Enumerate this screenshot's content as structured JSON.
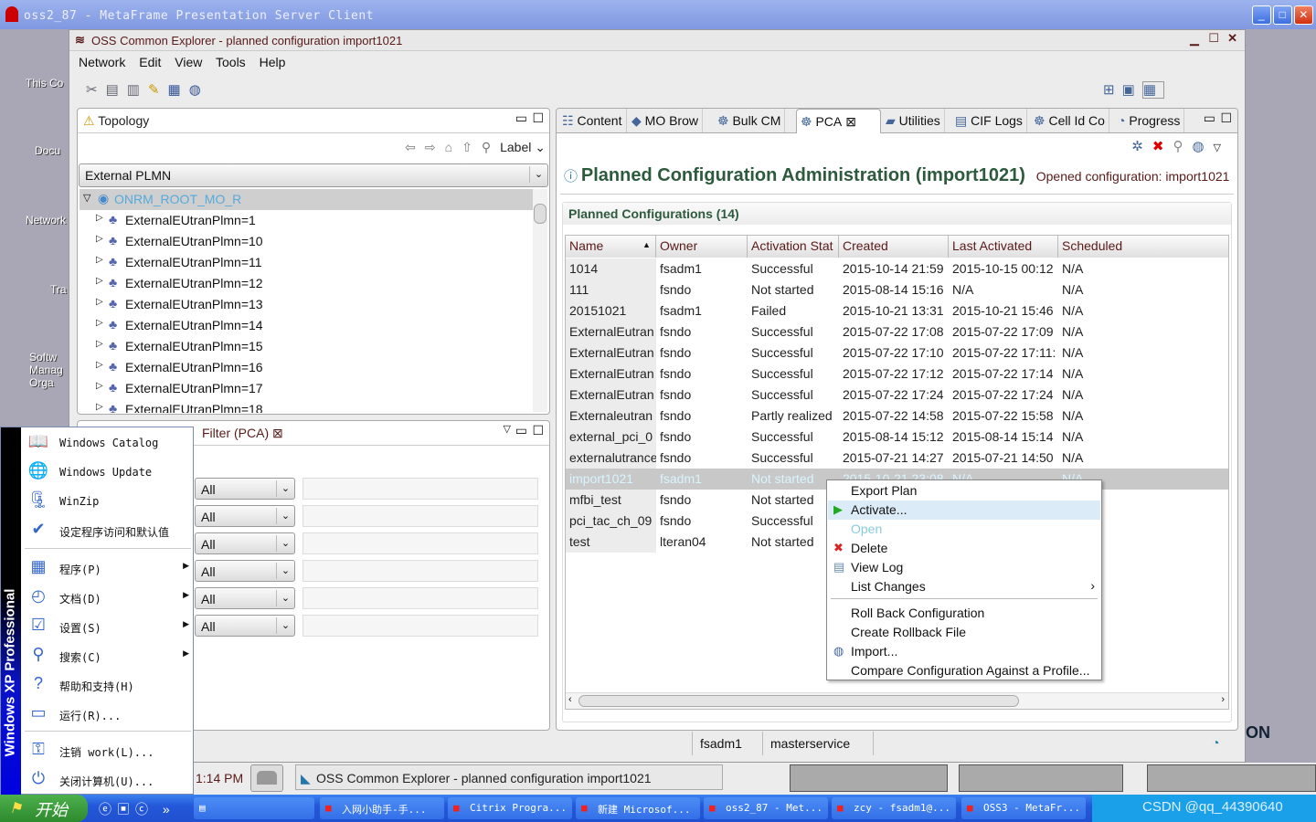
{
  "citrix_window": {
    "title": "oss2_87 - MetaFrame Presentation Server Client"
  },
  "desktop_icons": [
    "This Co",
    "Docu",
    "Network",
    "Tra",
    "Softw Manag Orga"
  ],
  "app": {
    "title": "OSS Common Explorer - planned configuration import1021",
    "menu": [
      "Network",
      "Edit",
      "View",
      "Tools",
      "Help"
    ]
  },
  "topology": {
    "tab": "Topology",
    "label_dropdown": "Label",
    "scope": "External PLMN",
    "root": "ONRM_ROOT_MO_R",
    "items": [
      "ExternalEUtranPlmn=1",
      "ExternalEUtranPlmn=10",
      "ExternalEUtranPlmn=11",
      "ExternalEUtranPlmn=12",
      "ExternalEUtranPlmn=13",
      "ExternalEUtranPlmn=14",
      "ExternalEUtranPlmn=15",
      "ExternalEUtranPlmn=16",
      "ExternalEUtranPlmn=17",
      "ExternalEUtranPlmn=18"
    ]
  },
  "filter": {
    "tab": "Filter (PCA)",
    "selects": [
      "All",
      "All",
      "All",
      "All",
      "All",
      "All"
    ]
  },
  "right_tabs": [
    "Content",
    "MO Brow",
    "Bulk CM",
    "PCA",
    "Utilities",
    "CIF Logs",
    "Cell Id Co",
    "Progress"
  ],
  "pca": {
    "title": "Planned Configuration Administration (import1021)",
    "opened": "Opened configuration: import1021",
    "section": "Planned Configurations (14)",
    "columns": [
      "Name",
      "Owner",
      "Activation Stat",
      "Created",
      "Last Activated",
      "Scheduled"
    ],
    "rows": [
      [
        "1014",
        "fsadm1",
        "Successful",
        "2015-10-14 21:59",
        "2015-10-15 00:12",
        "N/A"
      ],
      [
        "111",
        "fsndo",
        "Not started",
        "2015-08-14 15:16",
        "N/A",
        "N/A"
      ],
      [
        "20151021",
        "fsadm1",
        "Failed",
        "2015-10-21 13:31",
        "2015-10-21 15:46",
        "N/A"
      ],
      [
        "ExternalEutran",
        "fsndo",
        "Successful",
        "2015-07-22 17:08",
        "2015-07-22 17:09",
        "N/A"
      ],
      [
        "ExternalEutran",
        "fsndo",
        "Successful",
        "2015-07-22 17:10",
        "2015-07-22 17:11:",
        "N/A"
      ],
      [
        "ExternalEutran",
        "fsndo",
        "Successful",
        "2015-07-22 17:12",
        "2015-07-22 17:14",
        "N/A"
      ],
      [
        "ExternalEutran",
        "fsndo",
        "Successful",
        "2015-07-22 17:24",
        "2015-07-22 17:24",
        "N/A"
      ],
      [
        "Externaleutran",
        "fsndo",
        "Partly realized",
        "2015-07-22 14:58",
        "2015-07-22 15:58",
        "N/A"
      ],
      [
        "external_pci_0",
        "fsndo",
        "Successful",
        "2015-08-14 15:12",
        "2015-08-14 15:14",
        "N/A"
      ],
      [
        "externalutrance",
        "fsndo",
        "Successful",
        "2015-07-21 14:27",
        "2015-07-21 14:50",
        "N/A"
      ],
      [
        "import1021",
        "fsadm1",
        "Not started",
        "2015-10-21 23:08",
        "N/A",
        "N/A"
      ],
      [
        "mfbi_test",
        "fsndo",
        "Not started",
        "",
        "",
        ""
      ],
      [
        "pci_tac_ch_09",
        "fsndo",
        "Successful",
        "",
        "",
        ""
      ],
      [
        "test",
        "lteran04",
        "Not started",
        "",
        "",
        ""
      ]
    ],
    "selected_row": 10
  },
  "context_menu": [
    {
      "label": "Export Plan",
      "icon": ""
    },
    {
      "label": "Activate...",
      "icon": "play-icon",
      "highlighted": true
    },
    {
      "label": "Open",
      "icon": "",
      "disabled": true
    },
    {
      "label": "Delete",
      "icon": "delete-icon"
    },
    {
      "label": "View Log",
      "icon": "log-icon"
    },
    {
      "label": "List Changes",
      "icon": "",
      "submenu": true
    },
    {
      "label": "Roll Back Configuration",
      "icon": ""
    },
    {
      "label": "Create Rollback File",
      "icon": ""
    },
    {
      "label": "Import...",
      "icon": "import-icon"
    },
    {
      "label": "Compare Configuration Against a Profile...",
      "icon": ""
    }
  ],
  "status": {
    "user": "fsadm1",
    "service": "masterservice"
  },
  "remote_taskbar": {
    "time": "1:14 PM",
    "window": "OSS Common Explorer - planned configuration import1021",
    "side_text": "ON"
  },
  "start_menu": {
    "band": "Windows XP Professional",
    "items": [
      "Windows Catalog",
      "Windows Update",
      "WinZip",
      "设定程序访问和默认值",
      "程序(P)",
      "文档(D)",
      "设置(S)",
      "搜索(C)",
      "帮助和支持(H)",
      "运行(R)...",
      "注销 work(L)...",
      "关闭计算机(U)..."
    ]
  },
  "taskbar": {
    "start": "开始",
    "buttons": [
      "",
      "入网小助手-手...",
      "Citrix Progra...",
      "新建 Microsof...",
      "oss2_87 - Met...",
      "zcy - fsadm1@...",
      "OSS3 - MetaFr..."
    ],
    "watermark": "CSDN @qq_44390640"
  },
  "colors": {
    "xp_blue": "#2458d8",
    "selection": "#c8c8c8",
    "title_green": "#2d5a3c",
    "menu_highlight": "#dcebf8"
  }
}
